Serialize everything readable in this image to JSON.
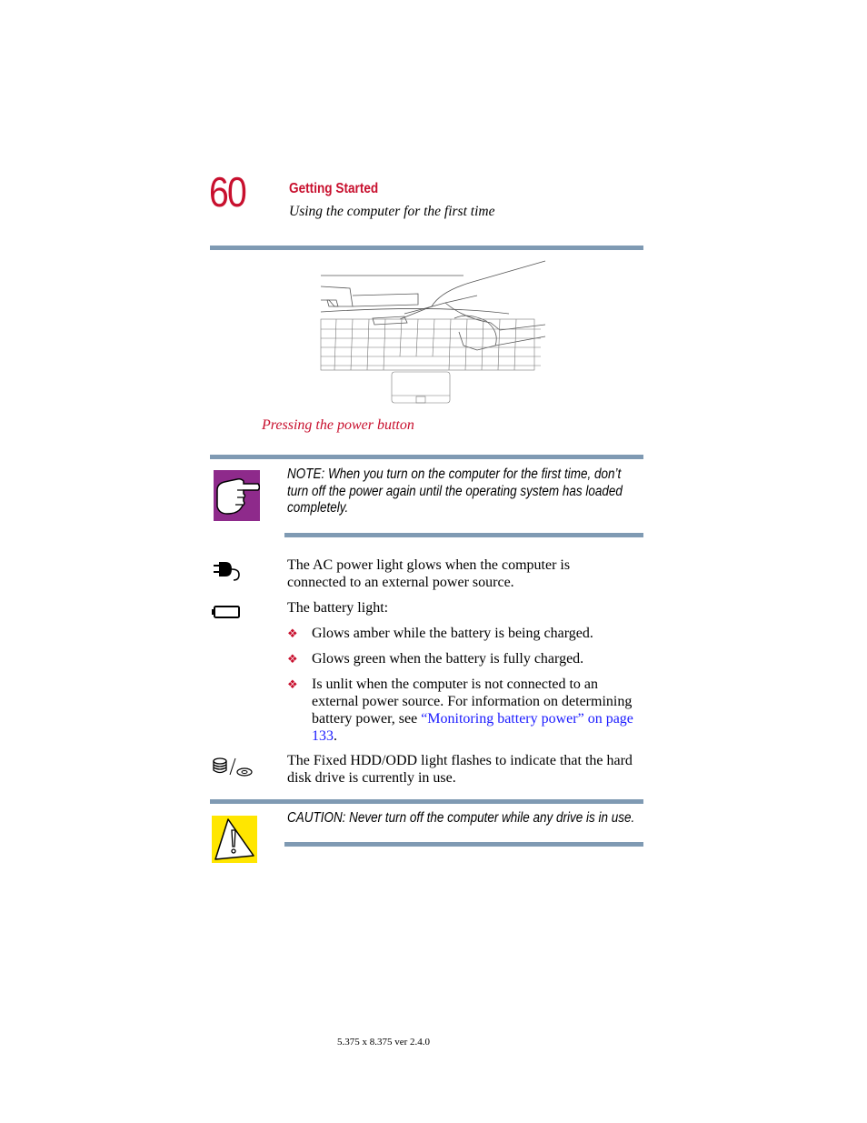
{
  "header": {
    "page_number": "60",
    "chapter_title": "Getting Started",
    "section_title": "Using the computer for the first time"
  },
  "figure": {
    "illustration": "hand-pressing-power-button-illustration",
    "caption": "Pressing the power button"
  },
  "note": {
    "icon": "pointing-hand-icon",
    "icon_color": "#8e2a8b",
    "text": "NOTE: When you turn on the computer for the first time, don’t turn off the power again until the operating system has loaded completely."
  },
  "indicators": [
    {
      "icon": "ac-power-plug-icon",
      "text": "The AC power light glows when the computer is connected to an external power source."
    },
    {
      "icon": "battery-icon",
      "text": "The battery light:"
    }
  ],
  "battery_bullets": [
    {
      "text": "Glows amber while the battery is being charged."
    },
    {
      "text": "Glows green when the battery is fully charged."
    },
    {
      "text": "Is unlit when the computer is not connected to an external power source. For information on determining battery power, see ",
      "link": "“Monitoring battery power” on page 133",
      "after": "."
    }
  ],
  "hdd": {
    "icon": "hdd-odd-icon",
    "text": "The Fixed HDD/ODD light flashes to indicate that the hard disk drive is currently in use."
  },
  "caution": {
    "icon": "caution-warning-icon",
    "icon_color": "#ffe600",
    "text": "CAUTION: Never turn off the computer while any drive is in use."
  },
  "footer": {
    "text": "5.375 x 8.375 ver 2.4.0"
  },
  "colors": {
    "accent_red": "#c8102e",
    "rule_blue": "#7f9ab3",
    "link_blue": "#1a1aff"
  }
}
